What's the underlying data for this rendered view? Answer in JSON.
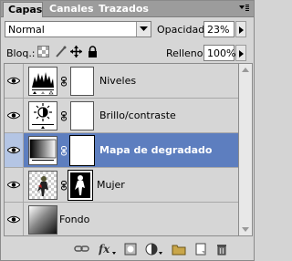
{
  "tabs": [
    {
      "label": "Capas"
    },
    {
      "label": "Canales"
    },
    {
      "label": "Trazados"
    }
  ],
  "blend_mode": {
    "value": "Normal"
  },
  "opacity": {
    "label": "Opacidad:",
    "value": "23%"
  },
  "lock": {
    "label": "Bloq.:",
    "icons": [
      "lock-transparent-icon",
      "lock-pixels-icon",
      "lock-position-icon",
      "lock-all-icon"
    ]
  },
  "fill": {
    "label": "Relleno:",
    "value": "100%"
  },
  "layers": [
    {
      "name": "Niveles",
      "type": "adjustment-levels",
      "selected": false
    },
    {
      "name": "Brillo/contraste",
      "type": "adjustment-brightness",
      "selected": false
    },
    {
      "name": "Mapa de degradado",
      "type": "adjustment-gradient-map",
      "selected": true
    },
    {
      "name": "Mujer",
      "type": "pixel-with-mask",
      "selected": false
    },
    {
      "name": "Fondo",
      "type": "background-gradient",
      "selected": false
    }
  ],
  "bottom_toolbar": [
    "link-layers-icon",
    "fx-icon",
    "add-mask-icon",
    "new-adjustment-icon",
    "new-group-icon",
    "new-layer-icon",
    "trash-icon"
  ],
  "colors": {
    "selected_row": "#5d7ebf",
    "panel_bg": "#d6d6d6",
    "tab_bar": "#9c9c9c"
  }
}
